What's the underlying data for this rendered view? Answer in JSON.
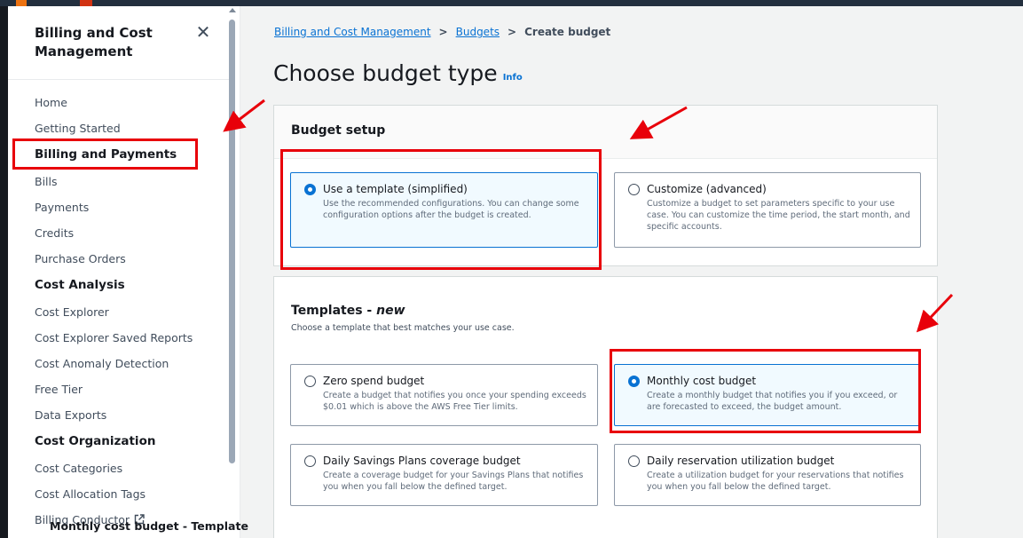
{
  "sidebar": {
    "title": "Billing and Cost Management",
    "close_icon": "close-icon",
    "nav": [
      {
        "label": "Home",
        "type": "link"
      },
      {
        "label": "Getting Started",
        "type": "link"
      },
      {
        "label": "Billing and Payments",
        "type": "section",
        "highlighted": true
      },
      {
        "label": "Bills",
        "type": "link"
      },
      {
        "label": "Payments",
        "type": "link"
      },
      {
        "label": "Credits",
        "type": "link"
      },
      {
        "label": "Purchase Orders",
        "type": "link"
      },
      {
        "label": "Cost Analysis",
        "type": "section"
      },
      {
        "label": "Cost Explorer",
        "type": "link"
      },
      {
        "label": "Cost Explorer Saved Reports",
        "type": "link"
      },
      {
        "label": "Cost Anomaly Detection",
        "type": "link"
      },
      {
        "label": "Free Tier",
        "type": "link"
      },
      {
        "label": "Data Exports",
        "type": "link"
      },
      {
        "label": "Cost Organization",
        "type": "section"
      },
      {
        "label": "Cost Categories",
        "type": "link"
      },
      {
        "label": "Cost Allocation Tags",
        "type": "link"
      },
      {
        "label": "Billing Conductor",
        "type": "link",
        "icon": "external-link-icon"
      }
    ]
  },
  "breadcrumb": {
    "items": [
      "Billing and Cost Management",
      "Budgets"
    ],
    "current": "Create budget"
  },
  "page": {
    "title": "Choose budget type",
    "info": "Info"
  },
  "budget_setup": {
    "title": "Budget setup",
    "options": [
      {
        "label": "Use a template (simplified)",
        "description": "Use the recommended configurations. You can change some configuration options after the budget is created.",
        "selected": true
      },
      {
        "label": "Customize (advanced)",
        "description": "Customize a budget to set parameters specific to your use case. You can customize the time period, the start month, and specific accounts.",
        "selected": false
      }
    ]
  },
  "templates": {
    "title_prefix": "Templates - ",
    "title_suffix": "new",
    "description": "Choose a template that best matches your use case.",
    "options": [
      {
        "label": "Zero spend budget",
        "description": "Create a budget that notifies you once your spending exceeds $0.01 which is above the AWS Free Tier limits.",
        "selected": false
      },
      {
        "label": "Monthly cost budget",
        "description": "Create a monthly budget that notifies you if you exceed, or are forecasted to exceed, the budget amount.",
        "selected": true
      },
      {
        "label": "Daily Savings Plans coverage budget",
        "description": "Create a coverage budget for your Savings Plans that notifies you when you fall below the defined target.",
        "selected": false
      },
      {
        "label": "Daily reservation utilization budget",
        "description": "Create a utilization budget for your reservations that notifies you when you fall below the defined target.",
        "selected": false
      }
    ]
  },
  "template_section": {
    "heading": "Monthly cost budget - Template"
  },
  "colors": {
    "accent": "#0972d3",
    "annotation": "#e8000a"
  }
}
